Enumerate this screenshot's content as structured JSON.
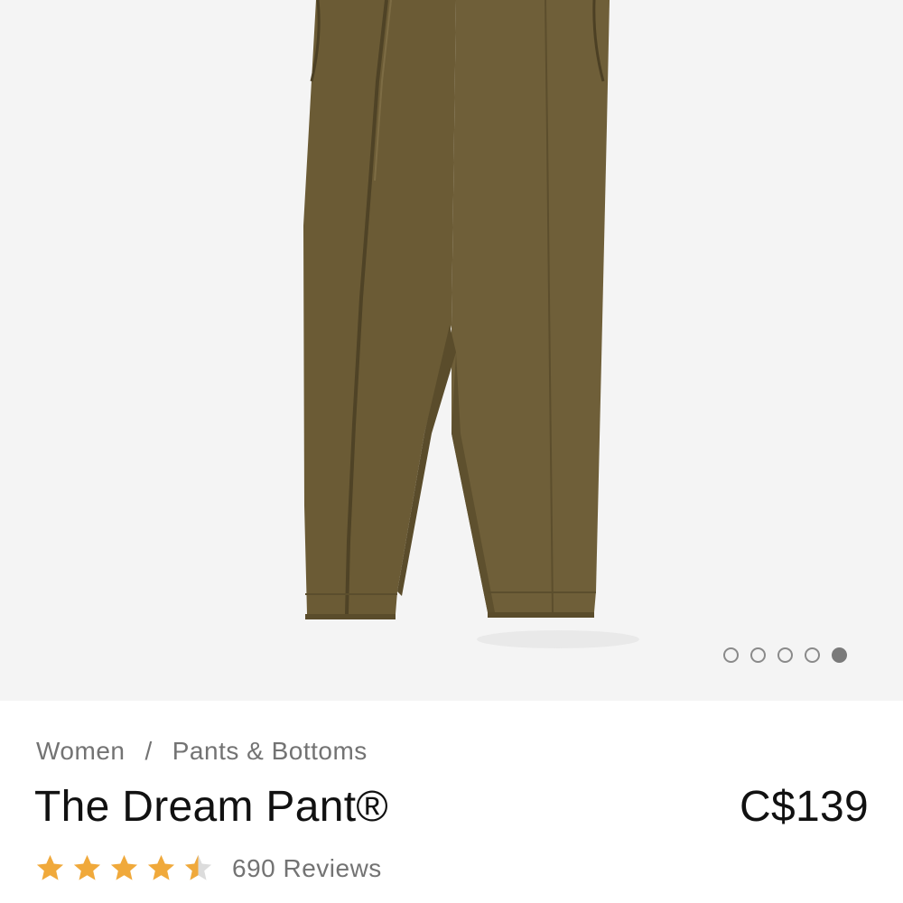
{
  "breadcrumb": {
    "items": [
      "Women",
      "Pants & Bottoms"
    ],
    "separator": "/"
  },
  "product": {
    "name": "The Dream Pant®",
    "price": "C$139",
    "rating": 4.5,
    "rating_max": 5,
    "reviews_label": "690 Reviews"
  },
  "gallery": {
    "image_count": 5,
    "active_index": 4
  },
  "colors": {
    "gallery_bg": "#f4f4f4",
    "star": "#f0a93b",
    "star_empty": "#dcdcdc",
    "pant": "#6b5b35",
    "text_muted": "#737373"
  }
}
